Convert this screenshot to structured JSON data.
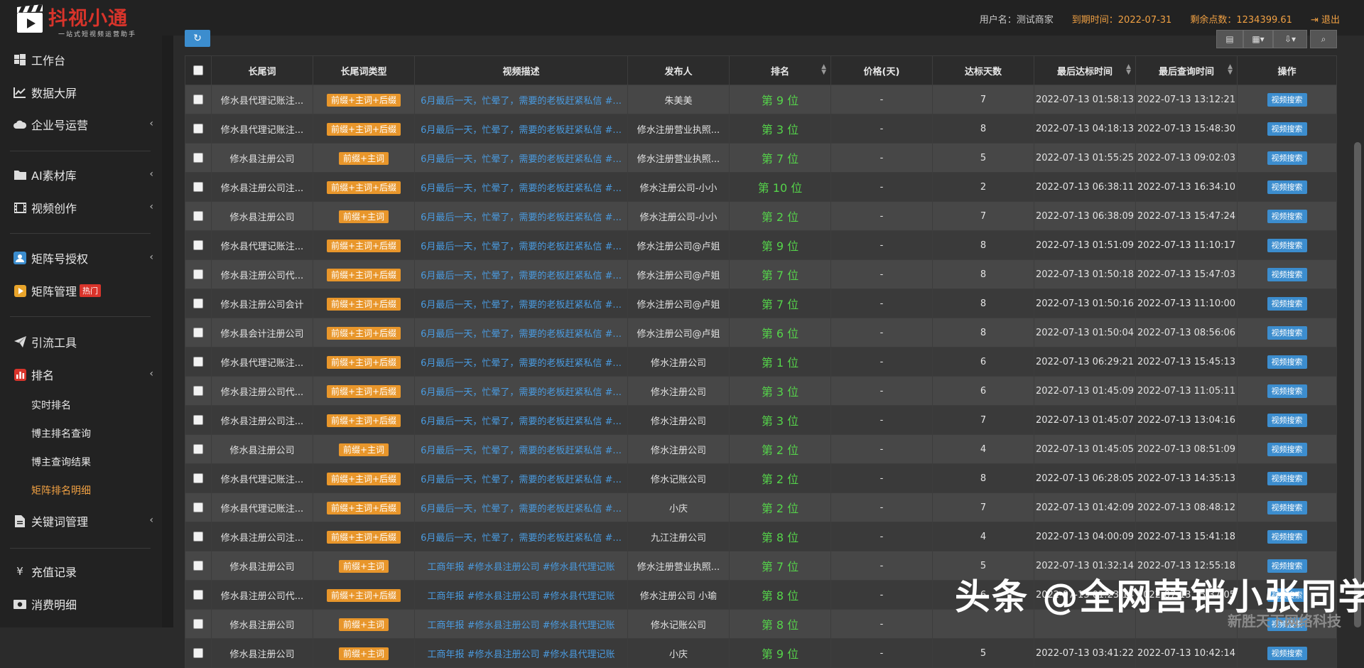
{
  "app": {
    "brand": "抖视小通",
    "slogan": "一站式短视频运营助手"
  },
  "topbar": {
    "user_label": "用户名：",
    "user_name": "测试商家",
    "expire_label": "到期时间：",
    "expire_date": "2022-07-31",
    "points_label": "剩余点数：",
    "points_value": "1234399.61",
    "logout": "退出"
  },
  "sidebar": {
    "workbench": "工作台",
    "dashboard": "数据大屏",
    "enterprise": "企业号运营",
    "ai_library": "AI素材库",
    "video_create": "视频创作",
    "matrix_auth": "矩阵号授权",
    "matrix_manage": "矩阵管理",
    "hot_badge": "热门",
    "traffic_tools": "引流工具",
    "ranking": "排名",
    "sub_realtime": "实时排名",
    "sub_blogger_query": "博主排名查询",
    "sub_blogger_result": "博主查询结果",
    "sub_matrix_detail": "矩阵排名明细",
    "keyword_manage": "关键词管理",
    "recharge": "充值记录",
    "consume": "消费明细"
  },
  "table": {
    "headers": [
      "长尾词",
      "长尾词类型",
      "视频描述",
      "发布人",
      "排名",
      "价格(天)",
      "达标天数",
      "最后达标时间",
      "最后查询时间",
      "操作"
    ],
    "action_label": "视频搜索",
    "rows": [
      [
        "修水县代理记账注...",
        "前缀+主词+后缀",
        "6月最后一天，忙晕了，需要的老板赶紧私信 #...",
        "朱美美",
        "第 9 位",
        "-",
        "7",
        "2022-07-13 01:58:13",
        "2022-07-13 13:12:21"
      ],
      [
        "修水县代理记账注...",
        "前缀+主词+后缀",
        "6月最后一天，忙晕了，需要的老板赶紧私信 #...",
        "修水注册营业执照...",
        "第 3 位",
        "-",
        "8",
        "2022-07-13 04:18:13",
        "2022-07-13 15:48:30"
      ],
      [
        "修水县注册公司",
        "前缀+主词",
        "6月最后一天，忙晕了，需要的老板赶紧私信 #...",
        "修水注册营业执照...",
        "第 7 位",
        "-",
        "5",
        "2022-07-13 01:55:25",
        "2022-07-13 09:02:03"
      ],
      [
        "修水县注册公司注...",
        "前缀+主词+后缀",
        "6月最后一天，忙晕了，需要的老板赶紧私信 #...",
        "修水注册公司-小小",
        "第 10 位",
        "-",
        "2",
        "2022-07-13 06:38:11",
        "2022-07-13 16:34:10"
      ],
      [
        "修水县注册公司",
        "前缀+主词",
        "6月最后一天，忙晕了，需要的老板赶紧私信 #...",
        "修水注册公司-小小",
        "第 2 位",
        "-",
        "7",
        "2022-07-13 06:38:09",
        "2022-07-13 15:47:24"
      ],
      [
        "修水县代理记账注...",
        "前缀+主词+后缀",
        "6月最后一天，忙晕了，需要的老板赶紧私信 #...",
        "修水注册公司@卢姐",
        "第 9 位",
        "-",
        "8",
        "2022-07-13 01:51:09",
        "2022-07-13 11:10:17"
      ],
      [
        "修水县注册公司代...",
        "前缀+主词+后缀",
        "6月最后一天，忙晕了，需要的老板赶紧私信 #...",
        "修水注册公司@卢姐",
        "第 7 位",
        "-",
        "8",
        "2022-07-13 01:50:18",
        "2022-07-13 15:47:03"
      ],
      [
        "修水县注册公司会计",
        "前缀+主词+后缀",
        "6月最后一天，忙晕了，需要的老板赶紧私信 #...",
        "修水注册公司@卢姐",
        "第 7 位",
        "-",
        "8",
        "2022-07-13 01:50:16",
        "2022-07-13 11:10:00"
      ],
      [
        "修水县会计注册公司",
        "前缀+主词+后缀",
        "6月最后一天，忙晕了，需要的老板赶紧私信 #...",
        "修水注册公司@卢姐",
        "第 6 位",
        "-",
        "8",
        "2022-07-13 01:50:04",
        "2022-07-13 08:56:06"
      ],
      [
        "修水县代理记账注...",
        "前缀+主词+后缀",
        "6月最后一天，忙晕了，需要的老板赶紧私信 #...",
        "修水注册公司",
        "第 1 位",
        "-",
        "6",
        "2022-07-13 06:29:21",
        "2022-07-13 15:45:13"
      ],
      [
        "修水县注册公司代...",
        "前缀+主词+后缀",
        "6月最后一天，忙晕了，需要的老板赶紧私信 #...",
        "修水注册公司",
        "第 3 位",
        "-",
        "6",
        "2022-07-13 01:45:09",
        "2022-07-13 11:05:11"
      ],
      [
        "修水县注册公司注...",
        "前缀+主词+后缀",
        "6月最后一天，忙晕了，需要的老板赶紧私信 #...",
        "修水注册公司",
        "第 3 位",
        "-",
        "7",
        "2022-07-13 01:45:07",
        "2022-07-13 13:04:16"
      ],
      [
        "修水县注册公司",
        "前缀+主词",
        "6月最后一天，忙晕了，需要的老板赶紧私信 #...",
        "修水注册公司",
        "第 2 位",
        "-",
        "4",
        "2022-07-13 01:45:05",
        "2022-07-13 08:51:09"
      ],
      [
        "修水县代理记账注...",
        "前缀+主词+后缀",
        "6月最后一天，忙晕了，需要的老板赶紧私信 #...",
        "修水记账公司",
        "第 2 位",
        "-",
        "8",
        "2022-07-13 06:28:05",
        "2022-07-13 14:35:13"
      ],
      [
        "修水县代理记账注...",
        "前缀+主词+后缀",
        "6月最后一天，忙晕了，需要的老板赶紧私信 #...",
        "小庆",
        "第 2 位",
        "-",
        "7",
        "2022-07-13 01:42:09",
        "2022-07-13 08:48:12"
      ],
      [
        "修水县注册公司注...",
        "前缀+主词+后缀",
        "6月最后一天，忙晕了，需要的老板赶紧私信 #...",
        "九江注册公司",
        "第 8 位",
        "-",
        "4",
        "2022-07-13 04:00:09",
        "2022-07-13 15:41:18"
      ],
      [
        "修水县注册公司",
        "前缀+主词",
        "工商年报 #修水县注册公司 #修水县代理记账",
        "修水注册营业执照...",
        "第 7 位",
        "-",
        "5",
        "2022-07-13 01:32:14",
        "2022-07-13 12:55:18"
      ],
      [
        "修水县注册公司代...",
        "前缀+主词+后缀",
        "工商年报 #修水县注册公司 #修水县代理记账",
        "修水注册公司 小瑜",
        "第 8 位",
        "-",
        "6",
        "2022-07-13 01:23:14",
        "2022-07-13 15:37:05"
      ],
      [
        "修水县注册公司",
        "前缀+主词",
        "工商年报 #修水县注册公司 #修水县代理记账",
        "修水记账公司",
        "第 8 位",
        "-",
        "",
        "",
        ""
      ],
      [
        "修水县注册公司",
        "前缀+主词",
        "工商年报 #修水县注册公司 #修水县代理记账",
        "小庆",
        "第 9 位",
        "-",
        "5",
        "2022-07-13 03:41:22",
        "2022-07-13 10:42:14"
      ]
    ]
  },
  "watermark": {
    "main": "头条 @全网营销小张同学",
    "sub": "新胜天下网络科技"
  }
}
